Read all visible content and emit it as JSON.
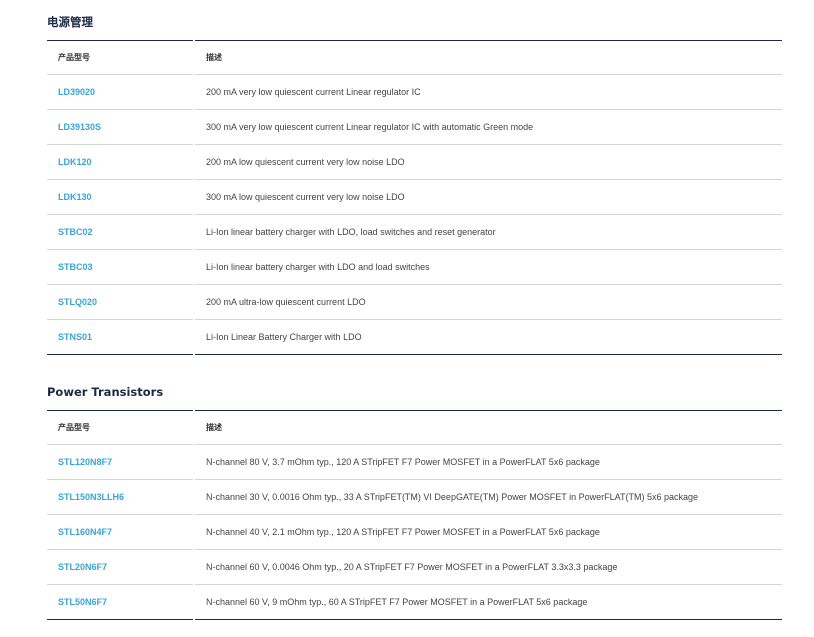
{
  "sections": [
    {
      "title": "电源管理",
      "col_part": "产品型号",
      "col_desc": "描述",
      "rows": [
        {
          "part": "LD39020",
          "desc": "200 mA very low quiescent current Linear regulator IC"
        },
        {
          "part": "LD39130S",
          "desc": "300 mA very low quiescent current Linear regulator IC with automatic Green mode"
        },
        {
          "part": "LDK120",
          "desc": "200 mA low quiescent current very low noise LDO"
        },
        {
          "part": "LDK130",
          "desc": "300 mA low quiescent current very low noise LDO"
        },
        {
          "part": "STBC02",
          "desc": "Li-Ion linear battery charger with LDO, load switches and reset generator"
        },
        {
          "part": "STBC03",
          "desc": "Li-Ion linear battery charger with LDO and load switches"
        },
        {
          "part": "STLQ020",
          "desc": "200 mA ultra-low quiescent current LDO"
        },
        {
          "part": "STNS01",
          "desc": "Li-Ion Linear Battery Charger with LDO"
        }
      ]
    },
    {
      "title": "Power Transistors",
      "col_part": "产品型号",
      "col_desc": "描述",
      "rows": [
        {
          "part": "STL120N8F7",
          "desc": "N-channel 80 V, 3.7 mOhm typ., 120 A STripFET F7 Power MOSFET in a PowerFLAT 5x6 package"
        },
        {
          "part": "STL150N3LLH6",
          "desc": "N-channel 30 V, 0.0016 Ohm typ., 33 A STripFET(TM) VI DeepGATE(TM) Power MOSFET in PowerFLAT(TM) 5x6 package"
        },
        {
          "part": "STL160N4F7",
          "desc": "N-channel 40 V, 2.1 mOhm typ., 120 A STripFET F7 Power MOSFET in a PowerFLAT 5x6 package"
        },
        {
          "part": "STL20N6F7",
          "desc": "N-channel 60 V, 0.0046 Ohm typ., 20 A STripFET F7 Power MOSFET in a PowerFLAT 3.3x3.3 package"
        },
        {
          "part": "STL50N6F7",
          "desc": "N-channel 60 V, 9 mOhm typ., 60 A STripFET F7 Power MOSFET in a PowerFLAT 5x6 package"
        }
      ]
    }
  ]
}
